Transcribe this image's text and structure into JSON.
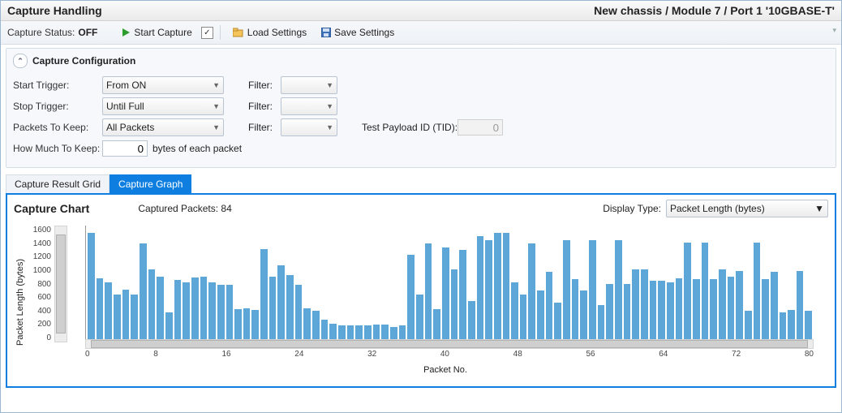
{
  "header": {
    "title": "Capture Handling",
    "context": "New chassis / Module 7 / Port 1 '10GBASE-T'"
  },
  "toolbar": {
    "status_label": "Capture Status:",
    "status_value": "OFF",
    "start_label": "Start Capture",
    "load_label": "Load Settings",
    "save_label": "Save Settings"
  },
  "config": {
    "panel_title": "Capture Configuration",
    "start_trigger_label": "Start Trigger:",
    "start_trigger_value": "From ON",
    "stop_trigger_label": "Stop Trigger:",
    "stop_trigger_value": "Until Full",
    "packets_keep_label": "Packets To Keep:",
    "packets_keep_value": "All Packets",
    "how_much_label": "How Much To Keep:",
    "how_much_value": "0",
    "how_much_suffix": "bytes of each packet",
    "filter_label": "Filter:",
    "tid_label": "Test Payload ID (TID):",
    "tid_value": "0"
  },
  "tabs": {
    "result_grid": "Capture Result Grid",
    "graph": "Capture Graph"
  },
  "chart": {
    "title": "Capture Chart",
    "captured_label": "Captured Packets: 84",
    "display_type_label": "Display Type:",
    "display_type_value": "Packet Length (bytes)",
    "xlabel": "Packet No.",
    "ylabel": "Packet Length (bytes)"
  },
  "chart_data": {
    "type": "bar",
    "xlabel": "Packet No.",
    "ylabel": "Packet Length (bytes)",
    "ylim": [
      0,
      1600
    ],
    "yticks": [
      0,
      200,
      400,
      600,
      800,
      1000,
      1200,
      1400,
      1600
    ],
    "xticks": [
      0,
      8,
      16,
      24,
      32,
      40,
      48,
      56,
      64,
      72,
      80
    ],
    "x_start": 0,
    "values": [
      1500,
      870,
      820,
      650,
      720,
      650,
      1350,
      1000,
      900,
      400,
      850,
      820,
      880,
      900,
      820,
      780,
      780,
      450,
      460,
      440,
      1280,
      900,
      1050,
      920,
      780,
      460,
      430,
      300,
      250,
      220,
      220,
      220,
      220,
      240,
      230,
      200,
      220,
      1200,
      650,
      1350,
      450,
      1300,
      1000,
      1270,
      560,
      1450,
      1400,
      1500,
      1500,
      820,
      650,
      1350,
      700,
      960,
      540,
      1400,
      860,
      700,
      1400,
      500,
      800,
      1400,
      800,
      1000,
      1000,
      840,
      840,
      820,
      870,
      1370,
      860,
      1370,
      860,
      1000,
      900,
      970,
      420,
      1370,
      860,
      960,
      400,
      440,
      970,
      420
    ]
  }
}
